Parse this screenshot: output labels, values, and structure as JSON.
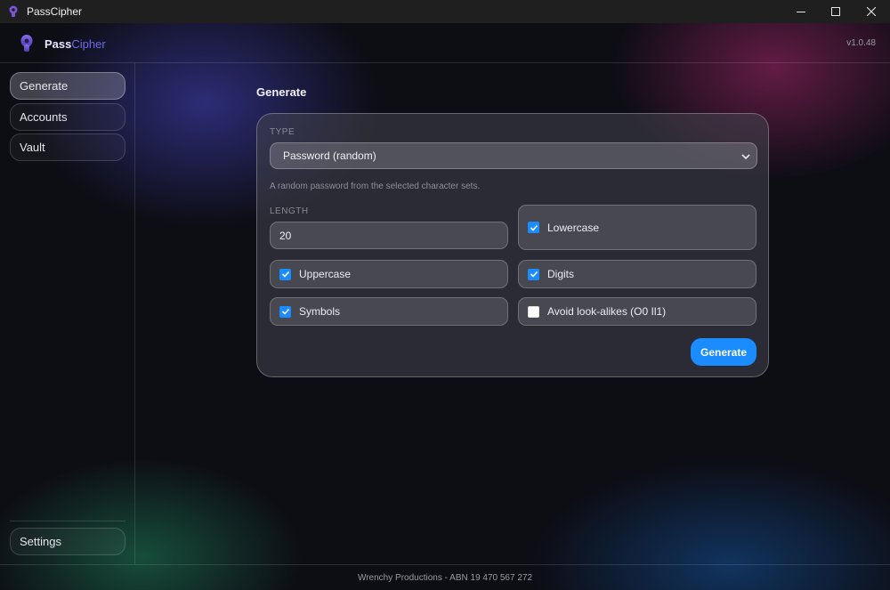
{
  "window": {
    "title": "PassCipher"
  },
  "header": {
    "brand_part1": "Pass",
    "brand_part2": "Cipher",
    "version": "v1.0.48"
  },
  "sidebar": {
    "items": [
      {
        "label": "Generate",
        "active": true
      },
      {
        "label": "Accounts",
        "active": false
      },
      {
        "label": "Vault",
        "active": false
      }
    ],
    "settings_label": "Settings"
  },
  "main": {
    "title": "Generate",
    "type_label": "TYPE",
    "type_value": "Password (random)",
    "type_hint": "A random password from the selected character sets.",
    "length_label": "LENGTH",
    "length_value": "20",
    "options": {
      "lowercase": {
        "label": "Lowercase",
        "checked": true
      },
      "uppercase": {
        "label": "Uppercase",
        "checked": true
      },
      "digits": {
        "label": "Digits",
        "checked": true
      },
      "symbols": {
        "label": "Symbols",
        "checked": true
      },
      "avoid_lookalikes": {
        "label": "Avoid look-alikes (O0 Il1)",
        "checked": false
      }
    },
    "generate_label": "Generate"
  },
  "footer": {
    "text": "Wrenchy Productions - ABN 19 470 567 272"
  },
  "colors": {
    "accent": "#1a8cff",
    "brand_secondary": "#6f6af0"
  },
  "icons": {
    "app": "app-logo-icon",
    "minimize": "minimize-icon",
    "maximize": "maximize-icon",
    "close": "close-icon",
    "dropdown": "chevron-down-icon",
    "check": "check-icon"
  }
}
